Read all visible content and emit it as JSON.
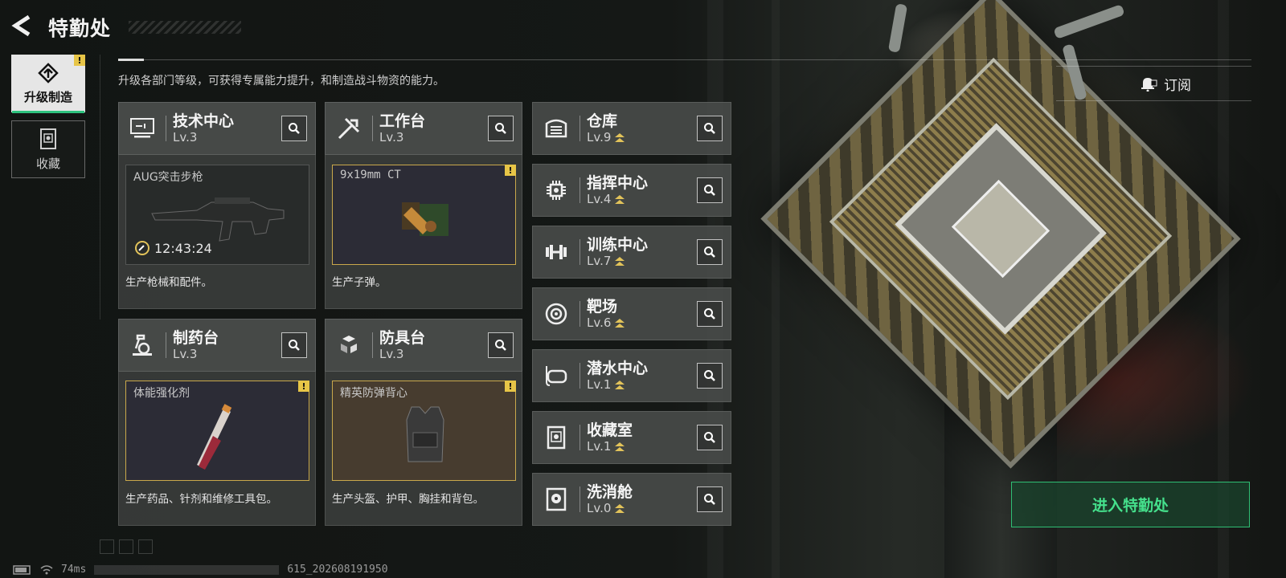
{
  "header": {
    "title": "特勤处",
    "back_icon": "back-arrow-icon"
  },
  "sidebar": {
    "items": [
      {
        "label": "升级制造",
        "icon": "upgrade-icon",
        "active": true,
        "alert": "!"
      },
      {
        "label": "收藏",
        "icon": "collection-icon",
        "active": false
      }
    ]
  },
  "description": "升级各部门等级，可获得专属能力提升，和制造战斗物资的能力。",
  "subscribe": {
    "label": "订阅",
    "icon": "bell-icon"
  },
  "production": [
    {
      "name": "技术中心",
      "level": "Lv.3",
      "icon": "monitor-icon",
      "product": "AUG突击步枪",
      "timer": "12:43:24",
      "desc": "生产枪械和配件。"
    },
    {
      "name": "工作台",
      "level": "Lv.3",
      "icon": "tools-icon",
      "product": "9x19mm CT",
      "alert": "!",
      "desc": "生产子弹。"
    },
    {
      "name": "制药台",
      "level": "Lv.3",
      "icon": "microscope-icon",
      "product": "体能强化剂",
      "alert": "!",
      "desc": "生产药品、针剂和维修工具包。"
    },
    {
      "name": "防具台",
      "level": "Lv.3",
      "icon": "armor-cubes-icon",
      "product": "精英防弹背心",
      "alert": "!",
      "desc": "生产头盔、护甲、胸挂和背包。"
    }
  ],
  "facilities": [
    {
      "name": "仓库",
      "level": "Lv.9",
      "icon": "warehouse-icon"
    },
    {
      "name": "指挥中心",
      "level": "Lv.4",
      "icon": "chip-icon"
    },
    {
      "name": "训练中心",
      "level": "Lv.7",
      "icon": "dumbbell-icon"
    },
    {
      "name": "靶场",
      "level": "Lv.6",
      "icon": "target-icon"
    },
    {
      "name": "潜水中心",
      "level": "Lv.1",
      "icon": "diving-mask-icon"
    },
    {
      "name": "收藏室",
      "level": "Lv.1",
      "icon": "display-case-icon"
    },
    {
      "name": "洗消舱",
      "level": "Lv.0",
      "icon": "biohazard-icon"
    }
  ],
  "enter_button": "进入特勤处",
  "status": {
    "ping": "74ms",
    "build": "615_202608191950"
  },
  "colors": {
    "accent": "#2fbf74",
    "alert": "#e7c547",
    "upgrade": "#e2c35a"
  }
}
